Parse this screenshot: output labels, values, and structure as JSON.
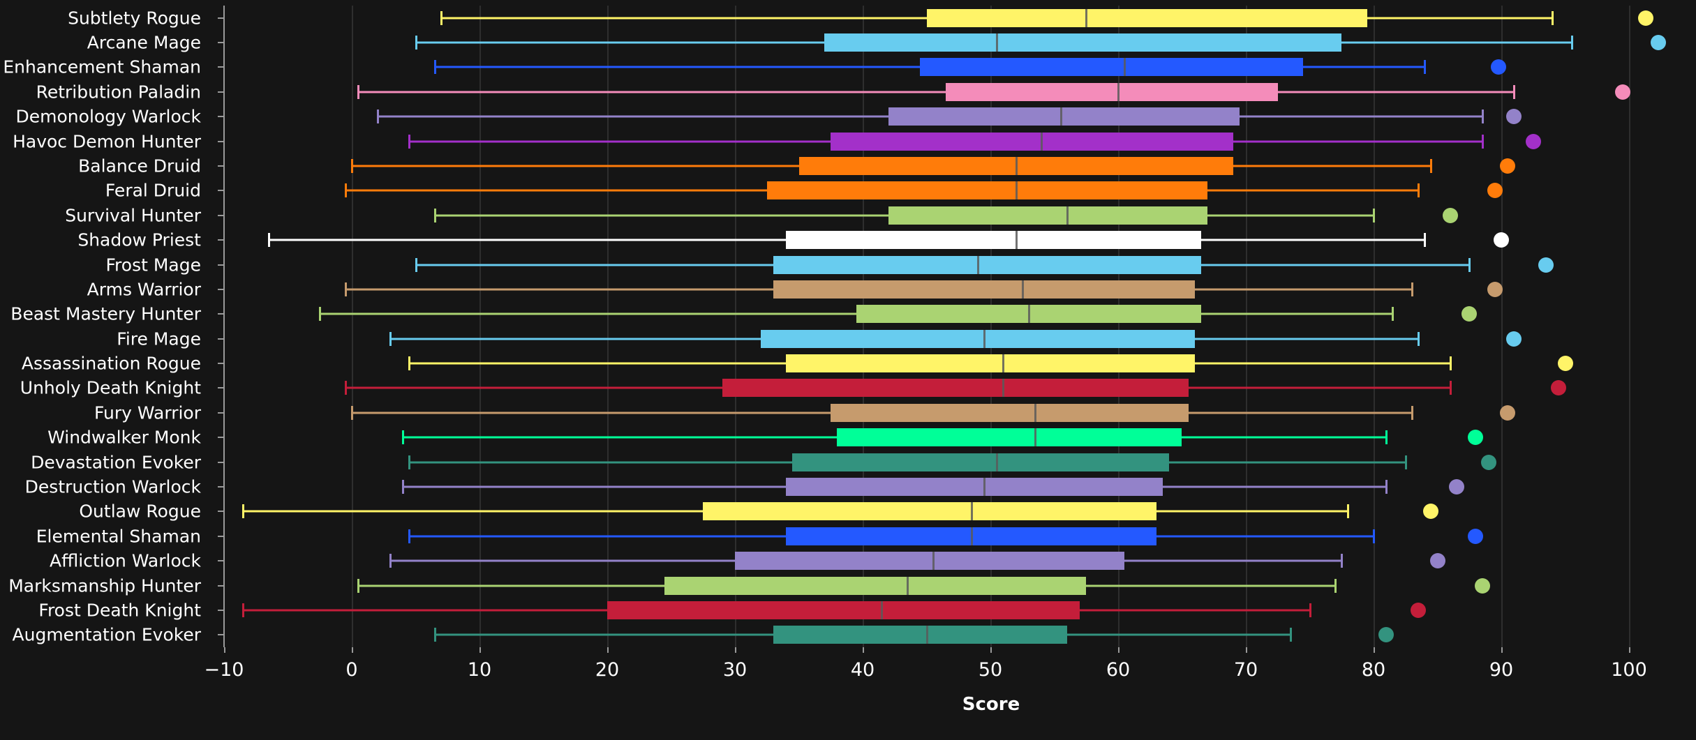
{
  "chart_data": {
    "type": "box",
    "title": "",
    "xlabel": "Score",
    "ylabel": "",
    "xlim": [
      -10,
      104
    ],
    "xticks": [
      -10,
      0,
      10,
      20,
      30,
      40,
      50,
      60,
      70,
      80,
      90,
      100
    ],
    "xtick_labels": [
      "−10",
      "0",
      "10",
      "20",
      "30",
      "40",
      "50",
      "60",
      "70",
      "80",
      "90",
      "100"
    ],
    "grid": "vertical",
    "legend": "none",
    "background": "#151515",
    "categories": [
      "Subtlety Rogue",
      "Arcane Mage",
      "Enhancement Shaman",
      "Retribution Paladin",
      "Demonology Warlock",
      "Havoc Demon Hunter",
      "Balance Druid",
      "Feral Druid",
      "Survival Hunter",
      "Shadow Priest",
      "Frost Mage",
      "Arms Warrior",
      "Beast Mastery Hunter",
      "Fire Mage",
      "Assassination Rogue",
      "Unholy Death Knight",
      "Fury Warrior",
      "Windwalker Monk",
      "Devastation Evoker",
      "Destruction Warlock",
      "Outlaw Rogue",
      "Elemental Shaman",
      "Affliction Warlock",
      "Marksmanship Hunter",
      "Frost Death Knight",
      "Augmentation Evoker"
    ],
    "boxes": [
      {
        "label": "Subtlety Rogue",
        "color": "#FFF468",
        "whisker_low": 7.0,
        "q1": 45.0,
        "median": 57.5,
        "q3": 79.5,
        "whisker_high": 94.0,
        "outliers": [
          101.3
        ]
      },
      {
        "label": "Arcane Mage",
        "color": "#68CCEF",
        "whisker_low": 5.0,
        "q1": 37.0,
        "median": 50.5,
        "q3": 77.5,
        "whisker_high": 95.5,
        "outliers": [
          102.3
        ]
      },
      {
        "label": "Enhancement Shaman",
        "color": "#2459FF",
        "whisker_low": 6.5,
        "q1": 44.5,
        "median": 60.5,
        "q3": 74.5,
        "whisker_high": 84.0,
        "outliers": [
          89.8
        ]
      },
      {
        "label": "Retribution Paladin",
        "color": "#F48CBA",
        "whisker_low": 0.5,
        "q1": 46.5,
        "median": 60.0,
        "q3": 72.5,
        "whisker_high": 91.0,
        "outliers": [
          99.5
        ]
      },
      {
        "label": "Demonology Warlock",
        "color": "#9382C9",
        "whisker_low": 2.0,
        "q1": 42.0,
        "median": 55.5,
        "q3": 69.5,
        "whisker_high": 88.5,
        "outliers": [
          91.0
        ]
      },
      {
        "label": "Havoc Demon Hunter",
        "color": "#A330C9",
        "whisker_low": 4.5,
        "q1": 37.5,
        "median": 54.0,
        "q3": 69.0,
        "whisker_high": 88.5,
        "outliers": [
          92.5
        ]
      },
      {
        "label": "Balance Druid",
        "color": "#FF7C0A",
        "whisker_low": 0.0,
        "q1": 35.0,
        "median": 52.0,
        "q3": 69.0,
        "whisker_high": 84.5,
        "outliers": [
          90.5
        ]
      },
      {
        "label": "Feral Druid",
        "color": "#FF7C0A",
        "whisker_low": -0.5,
        "q1": 32.5,
        "median": 52.0,
        "q3": 67.0,
        "whisker_high": 83.5,
        "outliers": [
          89.5
        ]
      },
      {
        "label": "Survival Hunter",
        "color": "#AAD372",
        "whisker_low": 6.5,
        "q1": 42.0,
        "median": 56.0,
        "q3": 67.0,
        "whisker_high": 80.0,
        "outliers": [
          86.0
        ]
      },
      {
        "label": "Shadow Priest",
        "color": "#FFFFFF",
        "whisker_low": -6.5,
        "q1": 34.0,
        "median": 52.0,
        "q3": 66.5,
        "whisker_high": 84.0,
        "outliers": [
          90.0
        ]
      },
      {
        "label": "Frost Mage",
        "color": "#68CCEF",
        "whisker_low": 5.0,
        "q1": 33.0,
        "median": 49.0,
        "q3": 66.5,
        "whisker_high": 87.5,
        "outliers": [
          93.5
        ]
      },
      {
        "label": "Arms Warrior",
        "color": "#C69B6D",
        "whisker_low": -0.5,
        "q1": 33.0,
        "median": 52.5,
        "q3": 66.0,
        "whisker_high": 83.0,
        "outliers": [
          89.5
        ]
      },
      {
        "label": "Beast Mastery Hunter",
        "color": "#AAD372",
        "whisker_low": -2.5,
        "q1": 39.5,
        "median": 53.0,
        "q3": 66.5,
        "whisker_high": 81.5,
        "outliers": [
          87.5
        ]
      },
      {
        "label": "Fire Mage",
        "color": "#68CCEF",
        "whisker_low": 3.0,
        "q1": 32.0,
        "median": 49.5,
        "q3": 66.0,
        "whisker_high": 83.5,
        "outliers": [
          91.0
        ]
      },
      {
        "label": "Assassination Rogue",
        "color": "#FFF468",
        "whisker_low": 4.5,
        "q1": 34.0,
        "median": 51.0,
        "q3": 66.0,
        "whisker_high": 86.0,
        "outliers": [
          95.0
        ]
      },
      {
        "label": "Unholy Death Knight",
        "color": "#C41E3A",
        "whisker_low": -0.5,
        "q1": 29.0,
        "median": 51.0,
        "q3": 65.5,
        "whisker_high": 86.0,
        "outliers": [
          94.5
        ]
      },
      {
        "label": "Fury Warrior",
        "color": "#C69B6D",
        "whisker_low": 0.0,
        "q1": 37.5,
        "median": 53.5,
        "q3": 65.5,
        "whisker_high": 83.0,
        "outliers": [
          90.5
        ]
      },
      {
        "label": "Windwalker Monk",
        "color": "#00FF98",
        "whisker_low": 4.0,
        "q1": 38.0,
        "median": 53.5,
        "q3": 65.0,
        "whisker_high": 81.0,
        "outliers": [
          88.0
        ]
      },
      {
        "label": "Devastation Evoker",
        "color": "#33937F",
        "whisker_low": 4.5,
        "q1": 34.5,
        "median": 50.5,
        "q3": 64.0,
        "whisker_high": 82.5,
        "outliers": [
          89.0
        ]
      },
      {
        "label": "Destruction Warlock",
        "color": "#9382C9",
        "whisker_low": 4.0,
        "q1": 34.0,
        "median": 49.5,
        "q3": 63.5,
        "whisker_high": 81.0,
        "outliers": [
          86.5
        ]
      },
      {
        "label": "Outlaw Rogue",
        "color": "#FFF468",
        "whisker_low": -8.5,
        "q1": 27.5,
        "median": 48.5,
        "q3": 63.0,
        "whisker_high": 78.0,
        "outliers": [
          84.5
        ]
      },
      {
        "label": "Elemental Shaman",
        "color": "#2459FF",
        "whisker_low": 4.5,
        "q1": 34.0,
        "median": 48.5,
        "q3": 63.0,
        "whisker_high": 80.0,
        "outliers": [
          88.0
        ]
      },
      {
        "label": "Affliction Warlock",
        "color": "#9382C9",
        "whisker_low": 3.0,
        "q1": 30.0,
        "median": 45.5,
        "q3": 60.5,
        "whisker_high": 77.5,
        "outliers": [
          85.0
        ]
      },
      {
        "label": "Marksmanship Hunter",
        "color": "#AAD372",
        "whisker_low": 0.5,
        "q1": 24.5,
        "median": 43.5,
        "q3": 57.5,
        "whisker_high": 77.0,
        "outliers": [
          88.5
        ]
      },
      {
        "label": "Frost Death Knight",
        "color": "#C41E3A",
        "whisker_low": -8.5,
        "q1": 20.0,
        "median": 41.5,
        "q3": 57.0,
        "whisker_high": 75.0,
        "outliers": [
          83.5
        ]
      },
      {
        "label": "Augmentation Evoker",
        "color": "#33937F",
        "whisker_low": 6.5,
        "q1": 33.0,
        "median": 45.0,
        "q3": 56.0,
        "whisker_high": 73.5,
        "outliers": [
          81.0
        ]
      }
    ]
  }
}
